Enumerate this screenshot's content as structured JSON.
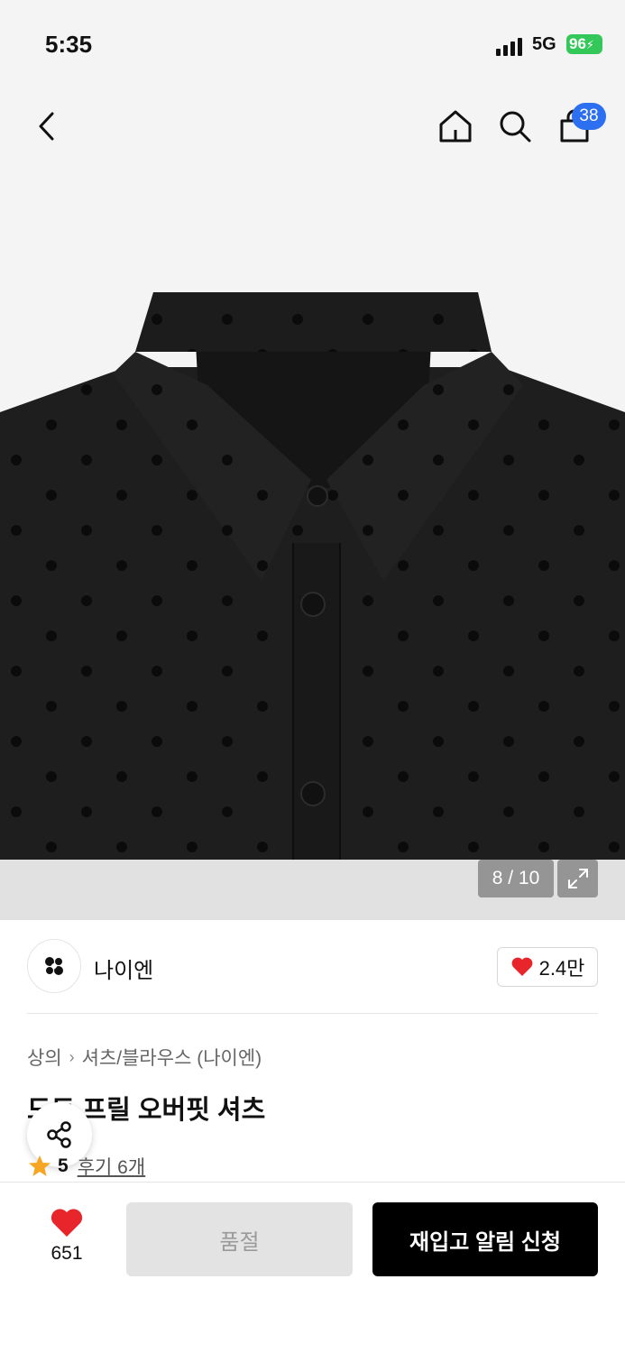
{
  "status_bar": {
    "time": "5:35",
    "network": "5G",
    "battery": "96"
  },
  "nav": {
    "back_icon": "chevron-left-icon",
    "home_icon": "home-icon",
    "search_icon": "search-icon",
    "cart_icon": "shopping-bag-icon",
    "cart_count": "38"
  },
  "gallery": {
    "counter": "8 / 10",
    "expand_icon": "expand-icon"
  },
  "brand": {
    "name": "나이엔",
    "logo_icon": "brand-logo-icon",
    "like_icon": "heart-icon",
    "like_count": "2.4만"
  },
  "product": {
    "breadcrumb": [
      "상의",
      "셔츠/블라우스 (나이엔)"
    ],
    "title": "도트 프릴 오버핏 셔츠",
    "rating": "5",
    "review_link": "후기 6개"
  },
  "share": {
    "icon": "share-icon"
  },
  "bottom_bar": {
    "wish_count": "651",
    "soldout_label": "품절",
    "restock_label": "재입고 알림 신청"
  },
  "colors": {
    "accent_blue": "#2c6ff0",
    "heart_red": "#e8252b",
    "star_orange": "#f5a623"
  }
}
